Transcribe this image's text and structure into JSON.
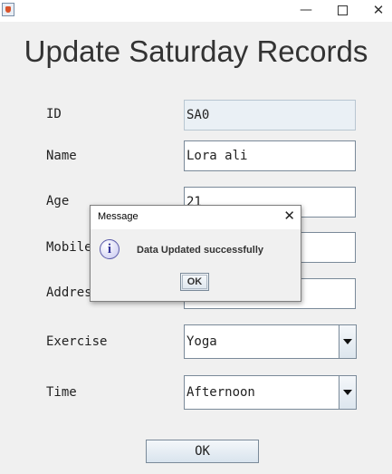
{
  "window": {
    "minimize_glyph": "—",
    "close_glyph": "✕"
  },
  "page": {
    "title": "Update Saturday Records"
  },
  "form": {
    "id": {
      "label": "ID",
      "value": "SA0"
    },
    "name": {
      "label": "Name",
      "value": "Lora ali"
    },
    "age": {
      "label": "Age",
      "value": "21"
    },
    "mobile": {
      "label": "Mobile",
      "value": ""
    },
    "address": {
      "label": "Address",
      "value": ""
    },
    "exercise": {
      "label": "Exercise",
      "value": "Yoga"
    },
    "time": {
      "label": "Time",
      "value": "Afternoon"
    },
    "ok_label": "OK"
  },
  "dialog": {
    "title": "Message",
    "close_glyph": "✕",
    "icon_glyph": "i",
    "message": "Data Updated successfully",
    "ok_label": "OK"
  },
  "colors": {
    "background": "#f0f0f0",
    "field_border": "#7a8a99",
    "disabled_field": "#eaf0f5",
    "info_icon": "#5a5aa8"
  }
}
